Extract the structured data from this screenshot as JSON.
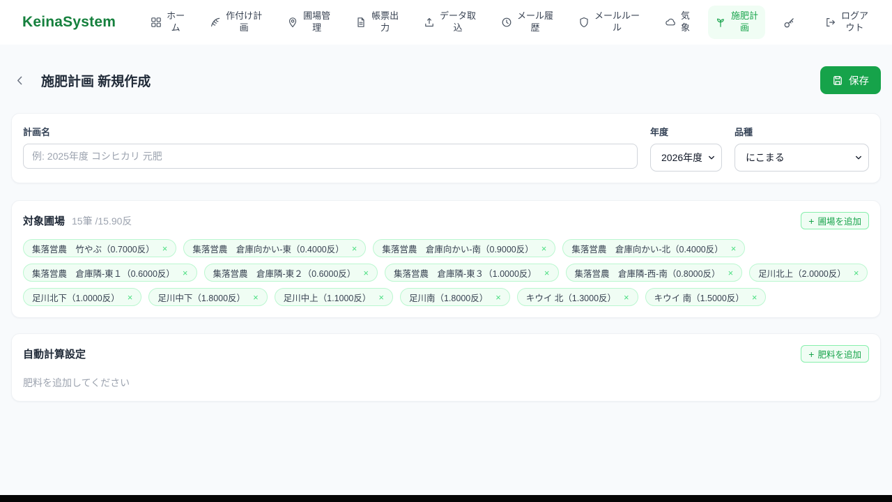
{
  "brand": "KeinaSystem",
  "nav": {
    "items": [
      {
        "label": "ホー\nム",
        "icon": "grid-icon"
      },
      {
        "label": "作付け計\n画",
        "icon": "wheat-icon"
      },
      {
        "label": "圃場管\n理",
        "icon": "map-pin-icon"
      },
      {
        "label": "帳票出\n力",
        "icon": "document-icon"
      },
      {
        "label": "データ取\n込",
        "icon": "upload-icon"
      },
      {
        "label": "メール履\n歴",
        "icon": "history-icon"
      },
      {
        "label": "メールルー\nル",
        "icon": "shield-icon"
      },
      {
        "label": "気\n象",
        "icon": "cloud-icon"
      },
      {
        "label": "施肥計\n画",
        "icon": "sprout-icon"
      },
      {
        "label": "",
        "icon": "key-icon"
      },
      {
        "label": "ログア\nウト",
        "icon": "logout-icon"
      }
    ]
  },
  "header": {
    "title": "施肥計画 新規作成",
    "save_label": "保存"
  },
  "form": {
    "plan_name": {
      "label": "計画名",
      "placeholder": "例: 2025年度 コシヒカリ 元肥",
      "value": ""
    },
    "year": {
      "label": "年度",
      "value": "2026年度"
    },
    "variety": {
      "label": "品種",
      "value": "にこまる"
    }
  },
  "fields_section": {
    "title": "対象圃場",
    "count": "15筆 /15.90反",
    "add_label": "圃場を追加",
    "plus_glyph": "+",
    "close_glyph": "×",
    "tags": [
      {
        "label": "集落営農　竹やぶ（0.7000反）"
      },
      {
        "label": "集落営農　倉庫向かい-東（0.4000反）"
      },
      {
        "label": "集落営農　倉庫向かい-南（0.9000反）"
      },
      {
        "label": "集落営農　倉庫向かい-北（0.4000反）"
      },
      {
        "label": "集落営農　倉庫隣-東１（0.6000反）"
      },
      {
        "label": "集落営農　倉庫隣-東２（0.6000反）"
      },
      {
        "label": "集落営農　倉庫隣-東３（1.0000反）"
      },
      {
        "label": "集落営農　倉庫隣-西-南（0.8000反）"
      },
      {
        "label": "足川北上（2.0000反）"
      },
      {
        "label": "足川北下（1.0000反）"
      },
      {
        "label": "足川中下（1.8000反）"
      },
      {
        "label": "足川中上（1.1000反）"
      },
      {
        "label": "足川南（1.8000反）"
      },
      {
        "label": "キウイ 北（1.3000反）"
      },
      {
        "label": "キウイ 南（1.5000反）"
      }
    ]
  },
  "auto_calc_section": {
    "title": "自動計算設定",
    "add_label": "肥料を追加",
    "plus_glyph": "+",
    "empty_text": "肥料を追加してください"
  },
  "colors": {
    "brand_green": "#15803d",
    "accent_green": "#16a34a",
    "light_green_bg": "#f0fdf4"
  }
}
